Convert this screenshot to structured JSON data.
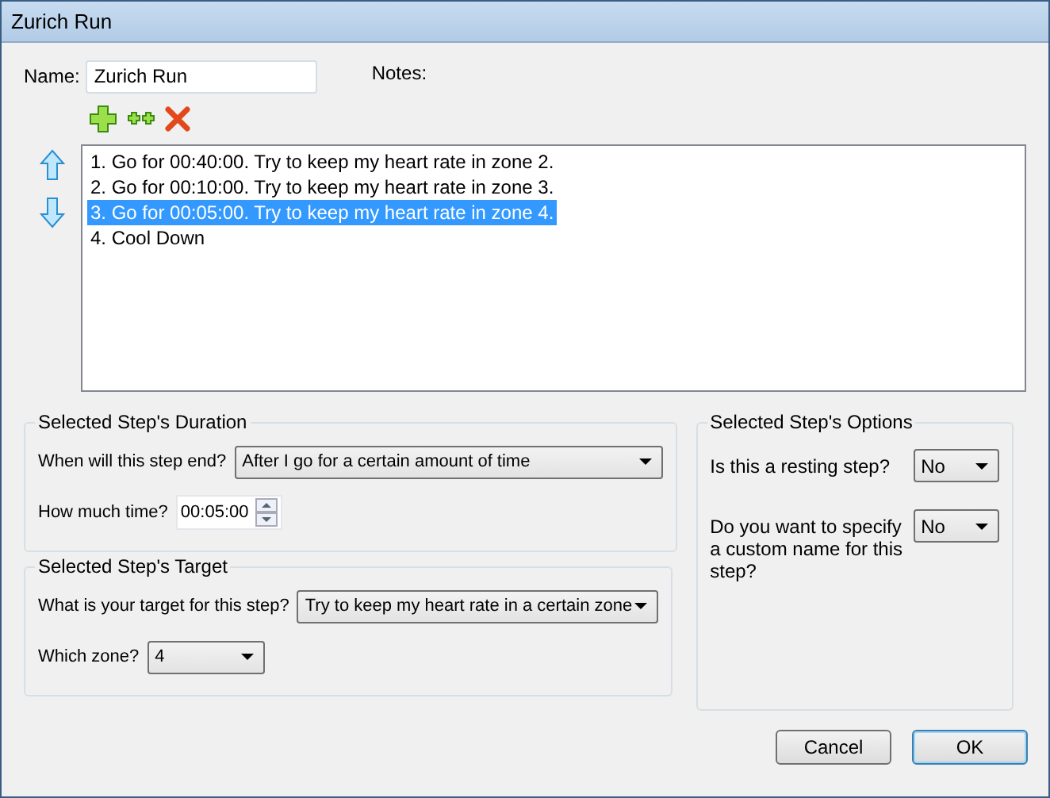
{
  "window": {
    "title": "Zurich Run"
  },
  "name_field": {
    "label": "Name:",
    "value": "Zurich Run"
  },
  "notes": {
    "label": "Notes:"
  },
  "steps": [
    {
      "text": "1. Go for 00:40:00. Try to keep my heart rate in zone 2.",
      "selected": false
    },
    {
      "text": "2. Go for 00:10:00. Try to keep my heart rate in zone 3.",
      "selected": false
    },
    {
      "text": "3. Go for 00:05:00. Try to keep my heart rate in zone 4.",
      "selected": true
    },
    {
      "text": "4. Cool Down",
      "selected": false
    }
  ],
  "duration": {
    "title": "Selected Step's Duration",
    "end_label": "When will this step end?",
    "end_value": "After I go for a certain amount of time",
    "time_label": "How much time?",
    "time_value": "00:05:00"
  },
  "target": {
    "title": "Selected Step's Target",
    "target_label": "What is your target for this step?",
    "target_value": "Try to keep my heart rate in a certain zone",
    "zone_label": "Which zone?",
    "zone_value": "4"
  },
  "options": {
    "title": "Selected Step's Options",
    "resting_label": "Is this a resting step?",
    "resting_value": "No",
    "custom_label": "Do you want to specify a custom name for this step?",
    "custom_value": "No"
  },
  "buttons": [
    {
      "label": "Cancel",
      "default": false
    },
    {
      "label": "OK",
      "default": true
    }
  ]
}
